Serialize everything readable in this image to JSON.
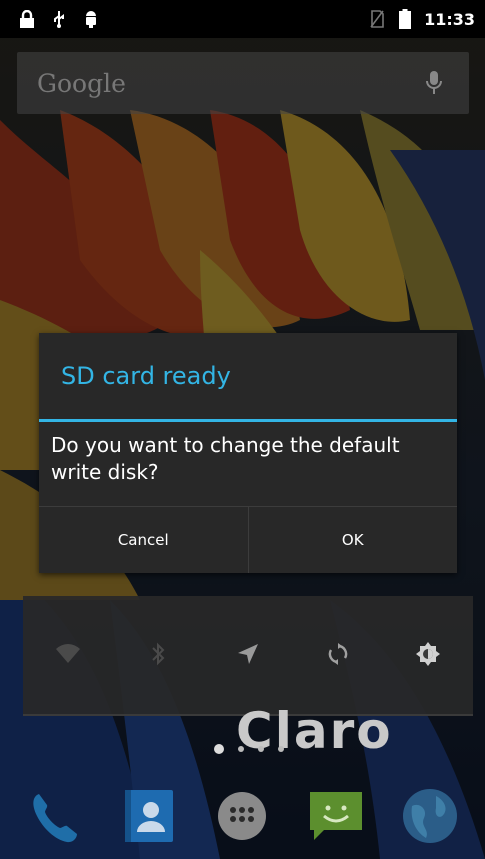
{
  "status_bar": {
    "time": "11:33",
    "left_icons": [
      "lock-icon",
      "usb-icon",
      "android-debug-icon"
    ],
    "right_icons": [
      "no-sim-icon",
      "battery-icon"
    ]
  },
  "search_widget": {
    "placeholder": "Google",
    "mic_icon": "microphone-icon"
  },
  "dialog": {
    "title": "SD card ready",
    "message": "Do you want to change the default write disk?",
    "cancel_label": "Cancel",
    "ok_label": "OK",
    "accent_color": "#33b5e5"
  },
  "power_widget": {
    "items": [
      "wifi-icon",
      "bluetooth-icon",
      "location-icon",
      "sync-icon",
      "brightness-icon"
    ]
  },
  "carrier_logo": "Claro",
  "home_pages": {
    "count": 4,
    "active": 0
  },
  "dock": {
    "items": [
      "phone-icon",
      "contacts-icon",
      "app-drawer-icon",
      "messaging-icon",
      "browser-icon"
    ]
  }
}
